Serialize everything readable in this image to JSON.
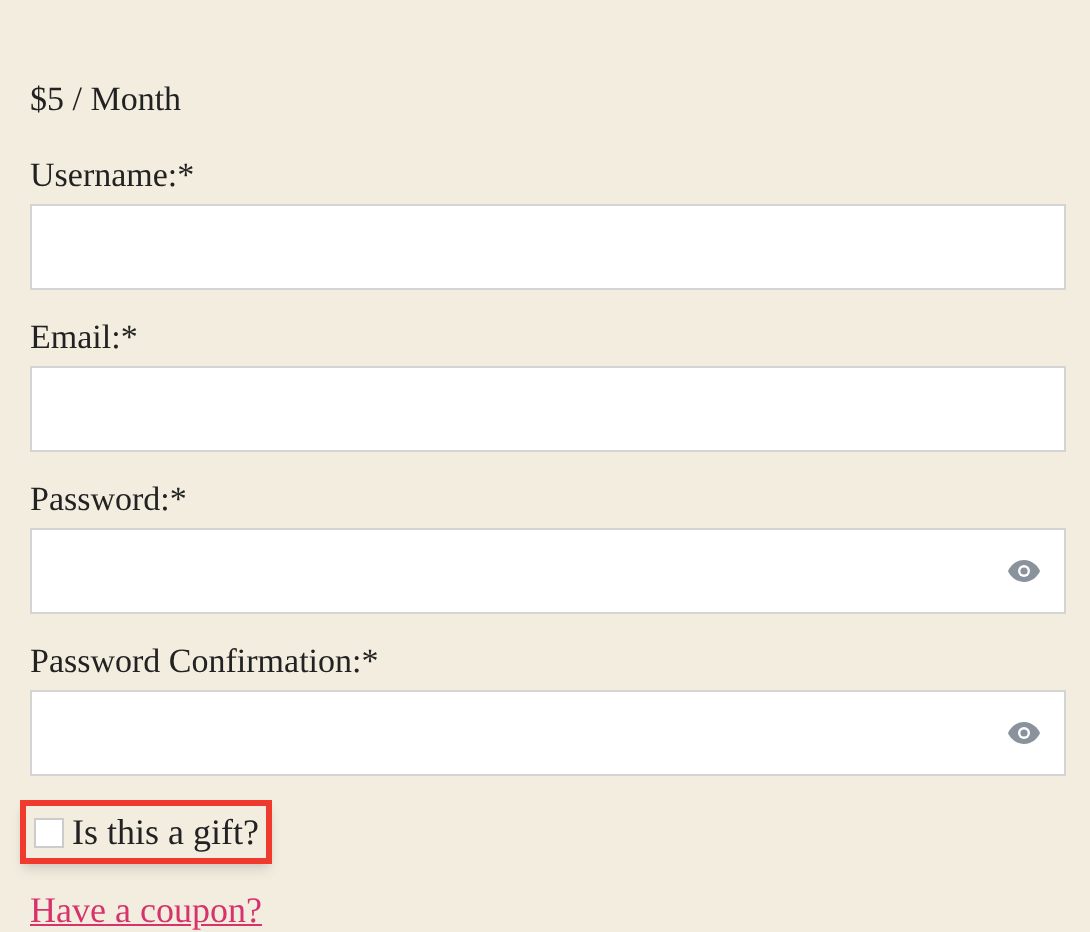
{
  "price": "$5 / Month",
  "fields": [
    {
      "label": "Username:*",
      "kind": "text"
    },
    {
      "label": "Email:*",
      "kind": "text"
    },
    {
      "label": "Password:*",
      "kind": "password"
    },
    {
      "label": "Password Confirmation:*",
      "kind": "password"
    }
  ],
  "gift": {
    "label": "Is this a gift?",
    "checked": false,
    "highlighted": true
  },
  "coupon_link": "Have a coupon?"
}
